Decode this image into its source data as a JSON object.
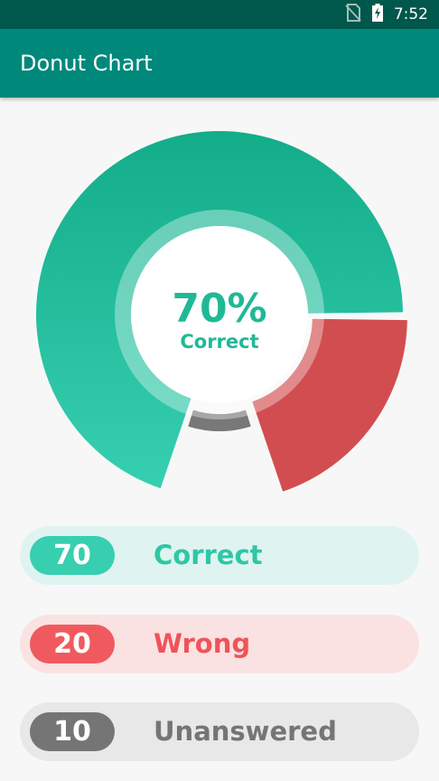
{
  "status_bar": {
    "time": "7:52",
    "icons": [
      "no-sim-icon",
      "battery-charging-icon"
    ]
  },
  "app_bar": {
    "title": "Donut Chart"
  },
  "colors": {
    "correct": "#20b995",
    "wrong": "#d24d4f",
    "unanswered": "#787878",
    "app_bar": "#00897b",
    "status_bar": "#00574b"
  },
  "center_label": {
    "percent": "70%",
    "caption": "Correct"
  },
  "chart_data": {
    "type": "pie",
    "donut": true,
    "categories": [
      "Correct",
      "Wrong",
      "Unanswered"
    ],
    "values": [
      70,
      20,
      10
    ],
    "colors": [
      "#20b995",
      "#d24d4f",
      "#787878"
    ]
  },
  "legend": [
    {
      "value": "70",
      "label": "Correct",
      "color": "#37cfb0",
      "text_color": "#2ec7a6",
      "bg": "#dff4f0"
    },
    {
      "value": "20",
      "label": "Wrong",
      "color": "#f05a5e",
      "text_color": "#ee5459",
      "bg": "#fbe2e2"
    },
    {
      "value": "10",
      "label": "Unanswered",
      "color": "#757575",
      "text_color": "#757575",
      "bg": "#e8e8e8"
    }
  ]
}
